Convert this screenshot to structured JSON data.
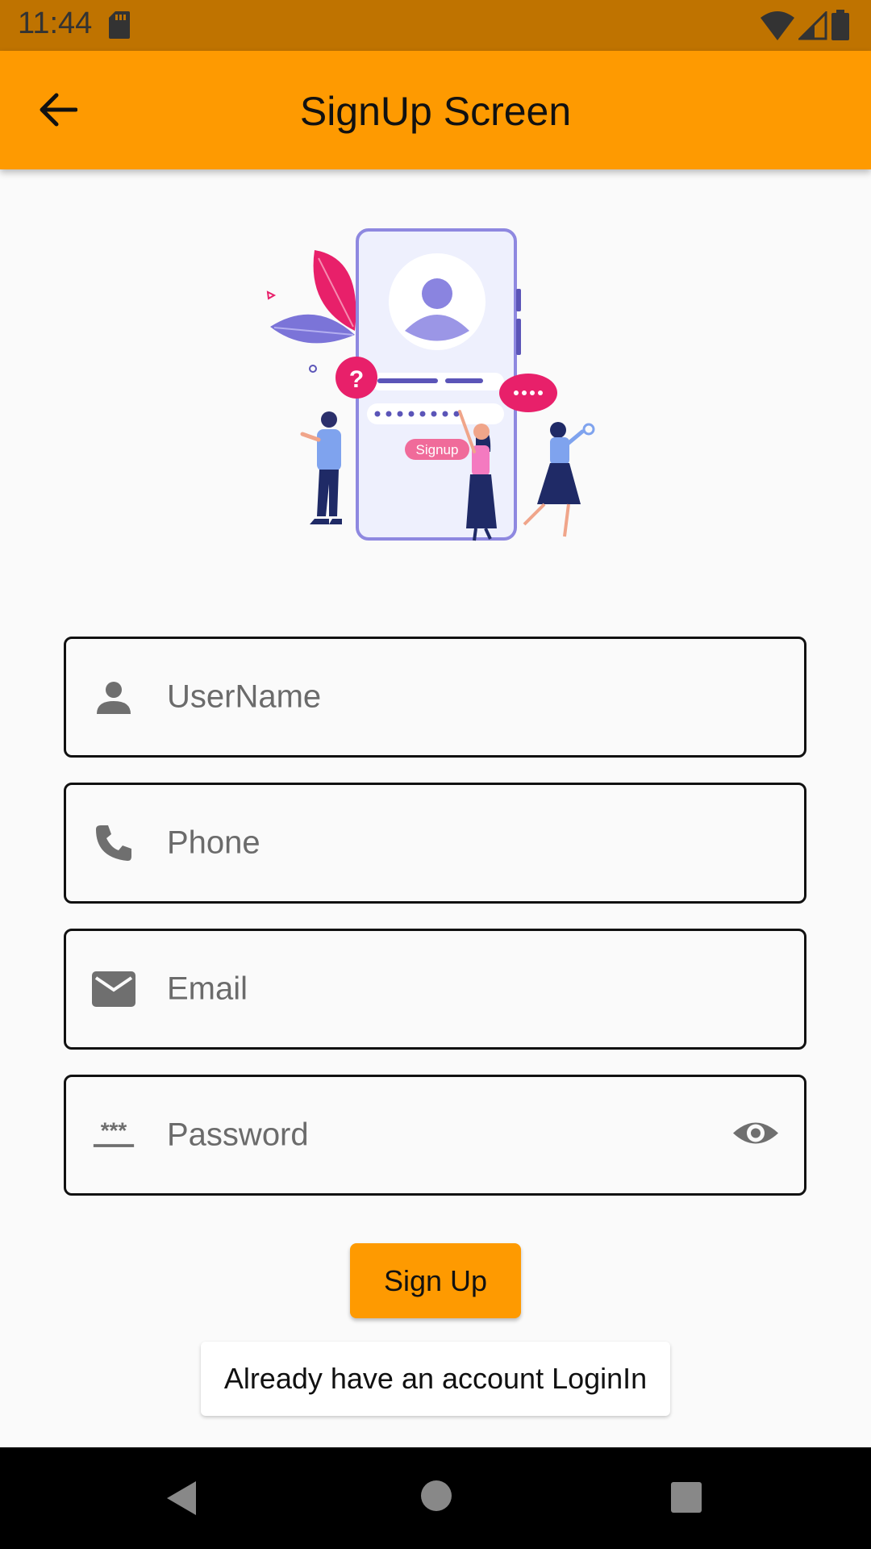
{
  "status_bar": {
    "time": "11:44",
    "icons": [
      "sd-card-icon",
      "wifi-icon",
      "signal-icon",
      "battery-icon"
    ]
  },
  "app_bar": {
    "title": "SignUp Screen",
    "back_icon": "arrow-back-icon"
  },
  "illustration": {
    "badge_text": "Signup"
  },
  "form": {
    "fields": [
      {
        "icon": "person-icon",
        "placeholder": "UserName"
      },
      {
        "icon": "phone-icon",
        "placeholder": "Phone"
      },
      {
        "icon": "email-icon",
        "placeholder": "Email"
      },
      {
        "icon": "password-icon",
        "placeholder": "Password",
        "trailing_icon": "eye-icon"
      }
    ],
    "signup_label": "Sign Up",
    "login_label": "Already have an account LoginIn"
  },
  "colors": {
    "accent": "#fe9a01",
    "status_bar": "#bf7300",
    "background": "#fafafa"
  }
}
